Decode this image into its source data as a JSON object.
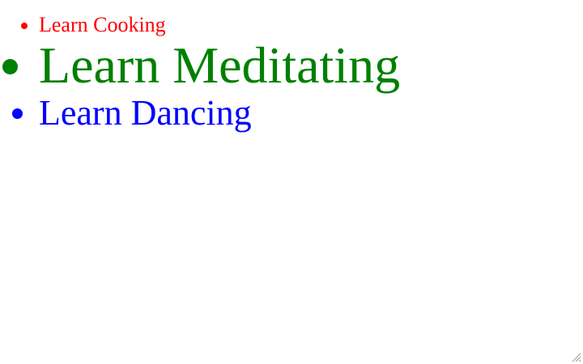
{
  "items": [
    {
      "label": "Learn Cooking",
      "color": "#ff0000"
    },
    {
      "label": "Learn Meditating",
      "color": "#008000"
    },
    {
      "label": "Learn Dancing",
      "color": "#0000ff"
    }
  ]
}
